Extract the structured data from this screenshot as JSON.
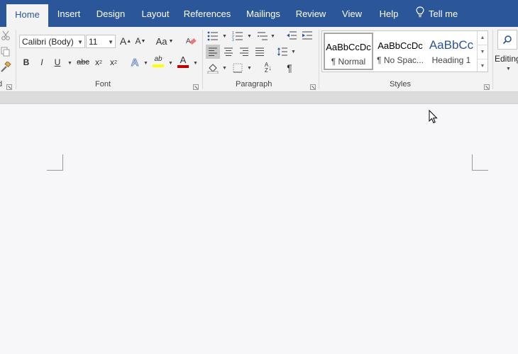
{
  "tabs": [
    {
      "label": "Home",
      "active": true
    },
    {
      "label": "Insert"
    },
    {
      "label": "Design"
    },
    {
      "label": "Layout"
    },
    {
      "label": "References"
    },
    {
      "label": "Mailings"
    },
    {
      "label": "Review"
    },
    {
      "label": "View"
    },
    {
      "label": "Help"
    }
  ],
  "tell_me": "Tell me",
  "font": {
    "family": "Calibri (Body)",
    "size": "11",
    "group_label": "Font",
    "bold": "B",
    "italic": "I",
    "underline": "U",
    "strikethrough": "abc",
    "subscript": "x",
    "subscript_mark": "2",
    "superscript": "x",
    "superscript_mark": "2",
    "change_case": "Aa",
    "grow": "A",
    "shrink": "A",
    "text_effects": "A",
    "font_color_letter": "A",
    "highlight_letters": "ab",
    "highlight_color": "#ffff00",
    "font_color": "#c00000"
  },
  "paragraph": {
    "group_label": "Paragraph",
    "pilcrow": "¶",
    "sort_top": "A",
    "sort_bottom": "Z"
  },
  "styles": {
    "group_label": "Styles",
    "items": [
      {
        "preview": "AaBbCcDc",
        "name": "¶ Normal",
        "selected": true
      },
      {
        "preview": "AaBbCcDc",
        "name": "¶ No Spac..."
      },
      {
        "preview": "AaBbCc",
        "name": "Heading 1",
        "color": "#2f5496"
      }
    ]
  },
  "editing": {
    "label": "Editing"
  }
}
